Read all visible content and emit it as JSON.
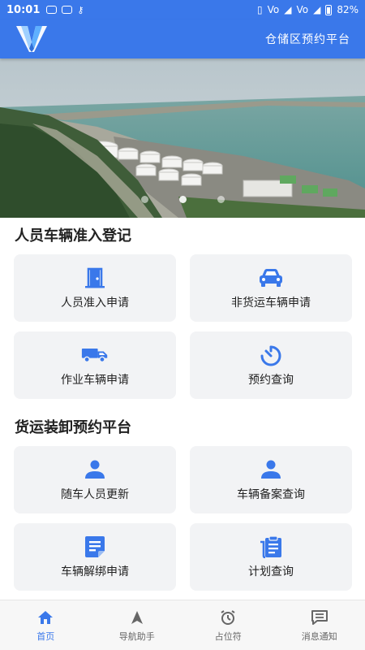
{
  "status_bar": {
    "time": "10:01",
    "network_1": "Vo",
    "network_2": "Vo",
    "battery": "82%"
  },
  "header": {
    "title": "仓储区预约平台"
  },
  "banner": {
    "slide_count": 3,
    "active_slide": 1
  },
  "section1": {
    "title": "人员车辆准入登记",
    "cards": [
      {
        "label": "人员准入申请",
        "icon": "door-icon"
      },
      {
        "label": "非货运车辆申请",
        "icon": "car-icon"
      },
      {
        "label": "作业车辆申请",
        "icon": "truck-icon"
      },
      {
        "label": "预约查询",
        "icon": "timer-icon"
      }
    ]
  },
  "section2": {
    "title": "货运装卸预约平台",
    "cards": [
      {
        "label": "随车人员更新",
        "icon": "person-icon"
      },
      {
        "label": "车辆备案查询",
        "icon": "person-icon"
      },
      {
        "label": "车辆解绑申请",
        "icon": "note-icon"
      },
      {
        "label": "计划查询",
        "icon": "clipboard-icon"
      }
    ]
  },
  "tabbar": {
    "tabs": [
      {
        "label": "首页",
        "icon": "home-icon",
        "active": true
      },
      {
        "label": "导航助手",
        "icon": "navigation-icon",
        "active": false
      },
      {
        "label": "占位符",
        "icon": "alarm-icon",
        "active": false
      },
      {
        "label": "消息通知",
        "icon": "message-icon",
        "active": false
      }
    ]
  },
  "colors": {
    "primary": "#3a78ea",
    "card_bg": "#f2f3f5"
  }
}
